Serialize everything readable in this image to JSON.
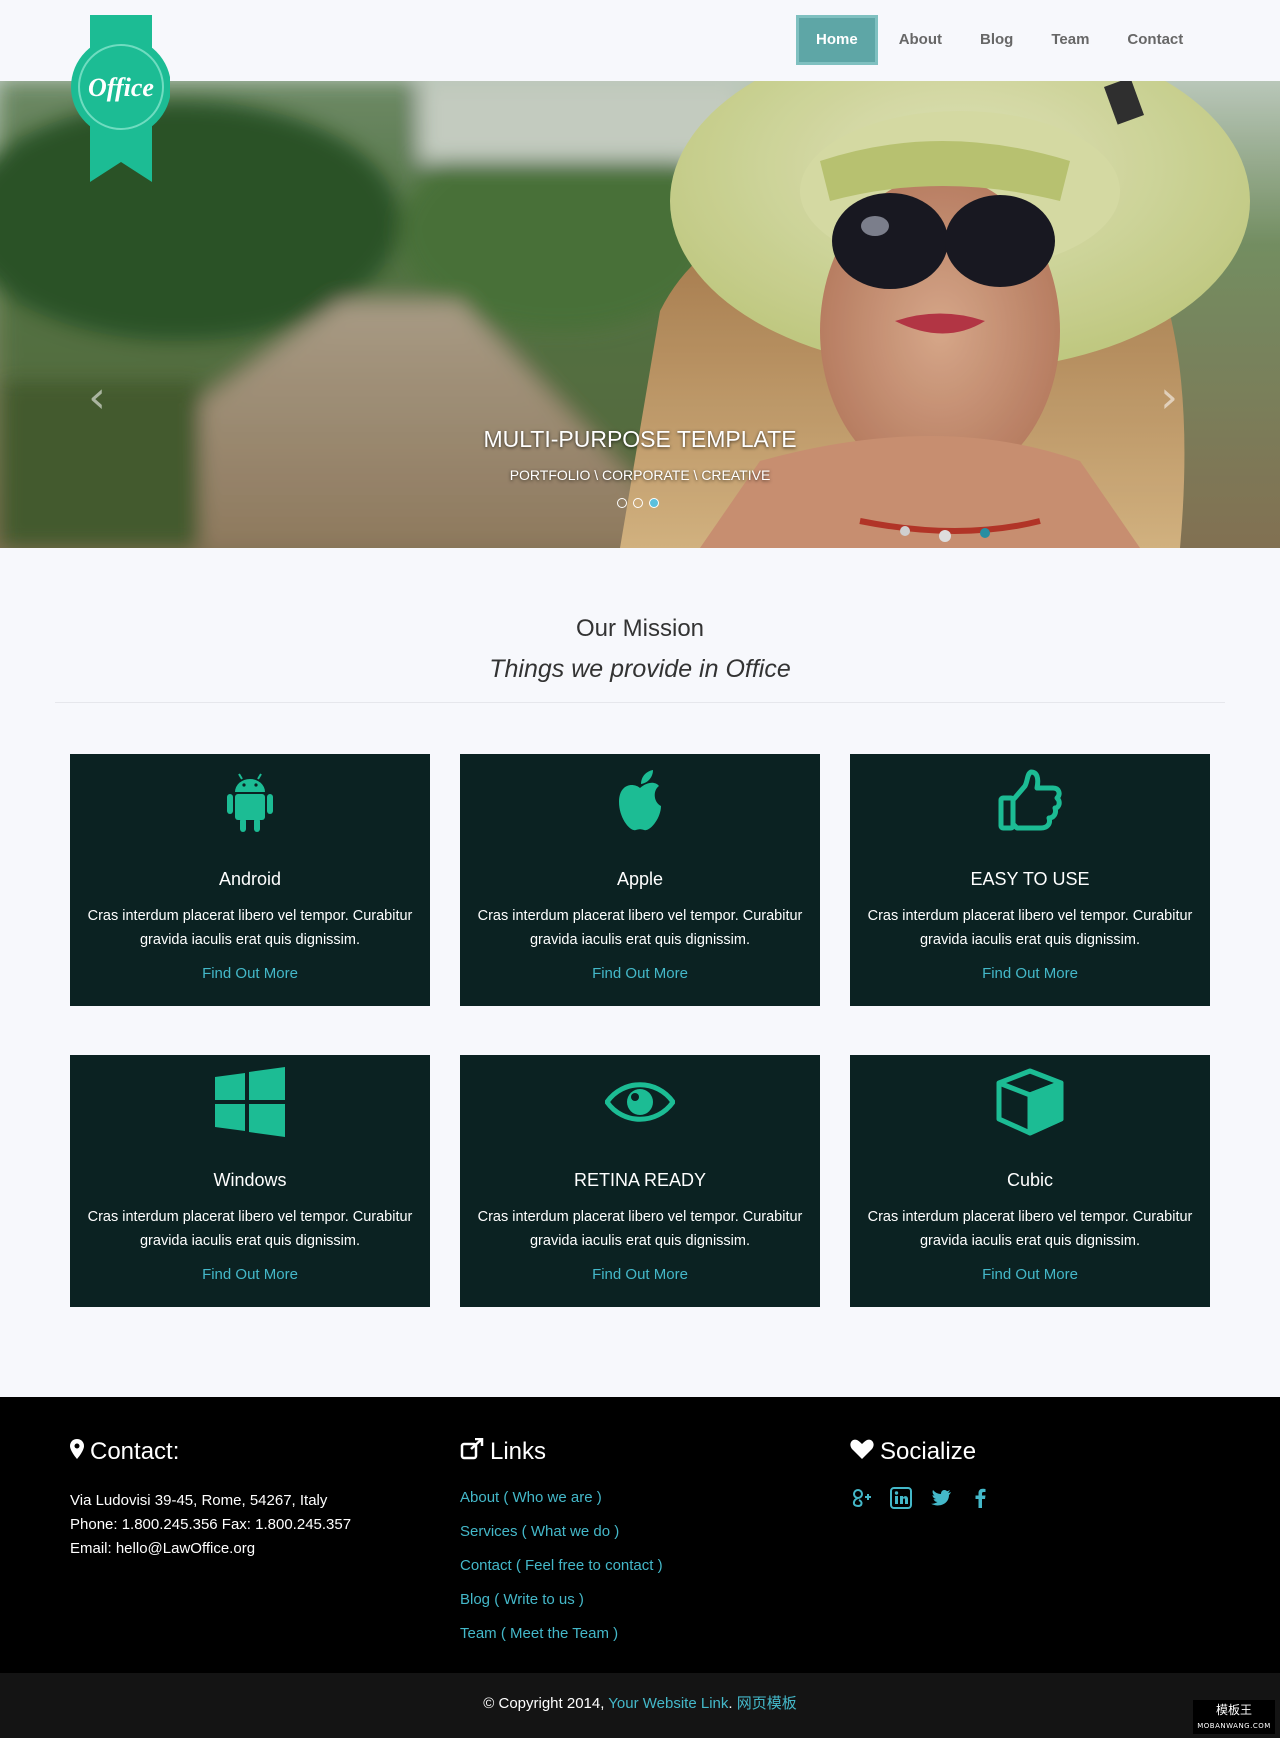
{
  "brand": {
    "logo_text": "Office",
    "accent": "#1cbc94"
  },
  "nav": {
    "items": [
      {
        "label": "Home",
        "active": true
      },
      {
        "label": "About"
      },
      {
        "label": "Blog"
      },
      {
        "label": "Team"
      },
      {
        "label": "Contact"
      }
    ]
  },
  "hero": {
    "title": "MULTI-PURPOSE TEMPLATE",
    "subtitle": "PORTFOLIO \\ CORPORATE \\ CREATIVE",
    "prev_glyph": "‹",
    "next_glyph": "›",
    "active_slide": 3,
    "slide_count": 3
  },
  "mission": {
    "title": "Our Mission",
    "subtitle": "Things we provide in Office"
  },
  "cards": [
    {
      "icon": "android-icon",
      "title": "Android",
      "desc": "Cras interdum placerat libero vel tempor. Curabitur gravida iaculis erat quis dignissim.",
      "link": "Find Out More"
    },
    {
      "icon": "apple-icon",
      "title": "Apple",
      "desc": "Cras interdum placerat libero vel tempor. Curabitur gravida iaculis erat quis dignissim.",
      "link": "Find Out More"
    },
    {
      "icon": "thumbs-up-icon",
      "title": "EASY TO USE",
      "desc": "Cras interdum placerat libero vel tempor. Curabitur gravida iaculis erat quis dignissim.",
      "link": "Find Out More"
    },
    {
      "icon": "windows-icon",
      "title": "Windows",
      "desc": "Cras interdum placerat libero vel tempor. Curabitur gravida iaculis erat quis dignissim.",
      "link": "Find Out More"
    },
    {
      "icon": "eye-icon",
      "title": "RETINA READY",
      "desc": "Cras interdum placerat libero vel tempor. Curabitur gravida iaculis erat quis dignissim.",
      "link": "Find Out More"
    },
    {
      "icon": "cube-icon",
      "title": "Cubic",
      "desc": "Cras interdum placerat libero vel tempor. Curabitur gravida iaculis erat quis dignissim.",
      "link": "Find Out More"
    }
  ],
  "footer": {
    "contact": {
      "heading": "Contact:",
      "address": "Via Ludovisi 39-45, Rome, 54267, Italy",
      "phone": "Phone: 1.800.245.356 Fax: 1.800.245.357",
      "email": "Email: hello@LawOffice.org"
    },
    "links": {
      "heading": "Links",
      "items": [
        "About ( Who we are )",
        "Services ( What we do )",
        "Contact ( Feel free to contact )",
        "Blog ( Write to us )",
        "Team ( Meet the Team )"
      ]
    },
    "social": {
      "heading": "Socialize",
      "icons": [
        "google-plus-icon",
        "linkedin-icon",
        "twitter-icon",
        "facebook-icon"
      ]
    }
  },
  "copyright": {
    "prefix": "© Copyright 2014, ",
    "link_text": "Your Website Link",
    "separator": ". ",
    "link2_text": "网页模板"
  },
  "watermark": {
    "line1": "模板王",
    "line2": "MOBANWANG.COM"
  }
}
